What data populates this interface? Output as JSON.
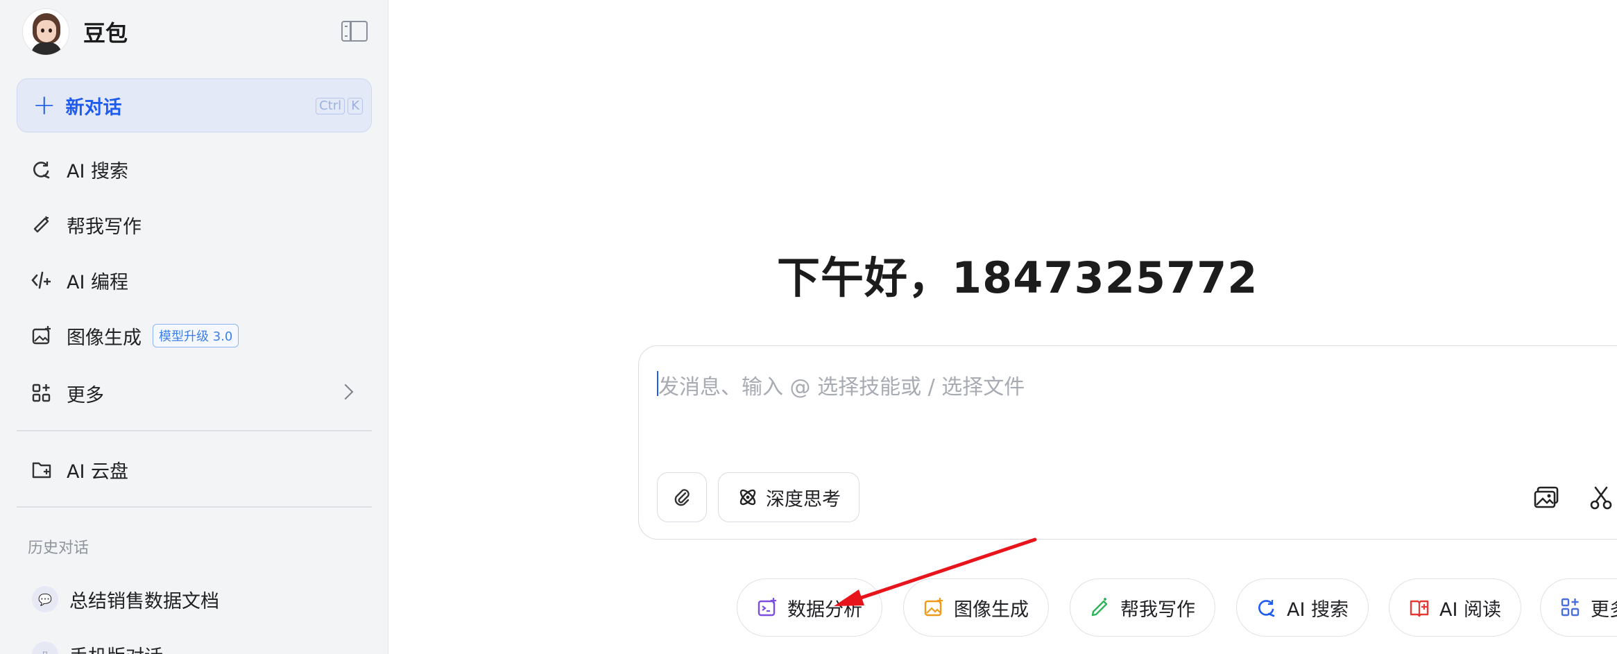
{
  "sidebar": {
    "brand": "豆包",
    "new_chat": {
      "label": "新对话",
      "kbd1": "Ctrl",
      "kbd2": "K"
    },
    "items": [
      {
        "label": "AI 搜索",
        "icon": "search-refresh-icon"
      },
      {
        "label": "帮我写作",
        "icon": "pen-icon"
      },
      {
        "label": "AI 编程",
        "icon": "code-icon"
      },
      {
        "label": "图像生成",
        "icon": "image-icon",
        "badge": "模型升级 3.0"
      },
      {
        "label": "更多",
        "icon": "apps-icon"
      }
    ],
    "cloud": {
      "label": "AI 云盘",
      "icon": "folder-plus-icon"
    },
    "history_title": "历史对话",
    "history": [
      {
        "label": "总结销售数据文档"
      },
      {
        "label": "手机版对话"
      }
    ]
  },
  "main": {
    "greeting": "下午好，1847325772",
    "composer": {
      "placeholder": "发消息、输入 @ 选择技能或 / 选择文件",
      "deep_think": "深度思考"
    },
    "chips": [
      {
        "label": "数据分析",
        "color": "#7b4de0"
      },
      {
        "label": "图像生成",
        "color": "#f09a1a"
      },
      {
        "label": "帮我写作",
        "color": "#2db35a"
      },
      {
        "label": "AI 搜索",
        "color": "#1e5cf0"
      },
      {
        "label": "AI 阅读",
        "color": "#e53935"
      },
      {
        "label": "更多",
        "color": "#4a6fdc"
      }
    ]
  },
  "colors": {
    "accent": "#1e5cf0",
    "annotation_arrow": "#e8141c"
  }
}
